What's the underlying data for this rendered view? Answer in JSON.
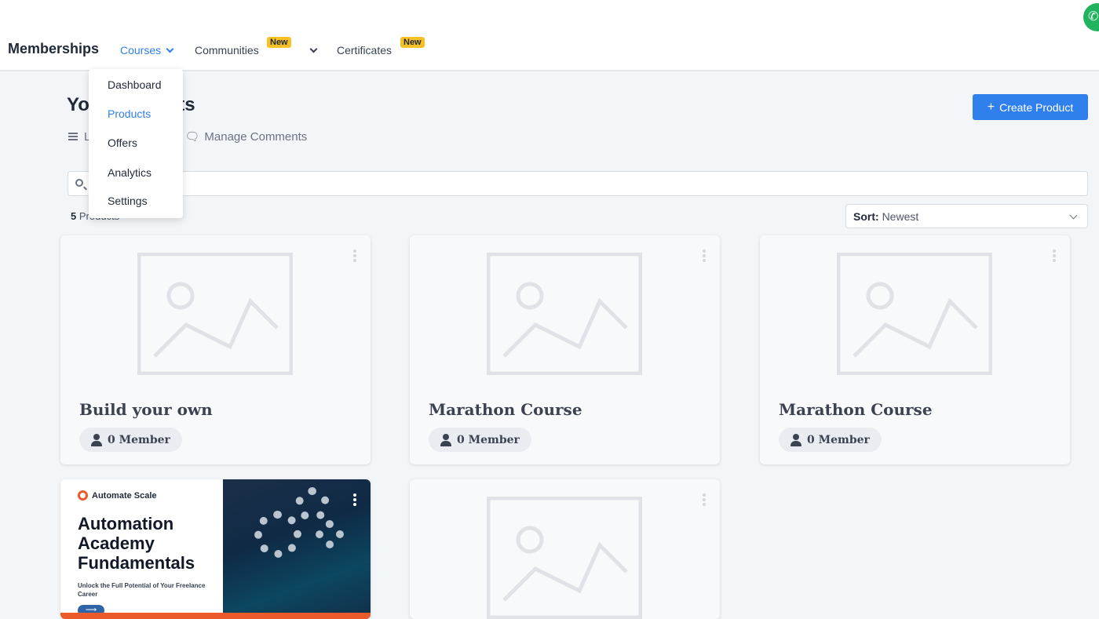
{
  "header": {
    "brand": "Memberships",
    "nav": {
      "courses": "Courses",
      "communities": "Communities",
      "certificates": "Certificates",
      "new_badge": "New"
    },
    "phone_icon": "phone-icon"
  },
  "courses_menu": {
    "items": [
      "Dashboard",
      "Products",
      "Offers",
      "Analytics",
      "Settings"
    ],
    "active": "Products"
  },
  "page": {
    "title": "Your Products",
    "subnav": {
      "list_label": "L",
      "manage_comments": "Manage Comments"
    },
    "create_button": "Create Product",
    "search": {
      "placeholder": "",
      "value": ""
    },
    "count": {
      "number": "5",
      "label": "Products"
    },
    "sort": {
      "label": "Sort:",
      "value": "Newest"
    }
  },
  "products": [
    {
      "title": "Build your own",
      "members": "0 Member"
    },
    {
      "title": "Marathon Course",
      "members": "0 Member"
    },
    {
      "title": "Marathon Course",
      "members": "0 Member"
    },
    {
      "title": "Automation Academy Fundamentals",
      "thumbnail": {
        "logo": "Automate Scale",
        "heading": "Automation Academy Fundamentals",
        "subtitle": "Unlock the Full Potential of Your Freelance Career",
        "arrow": "⟶"
      }
    },
    {
      "title": ""
    }
  ],
  "colors": {
    "accent": "#2f80ed",
    "badge": "#f6c026",
    "card_text": "#3b4351",
    "thumb_orange": "#ea5a2a"
  }
}
